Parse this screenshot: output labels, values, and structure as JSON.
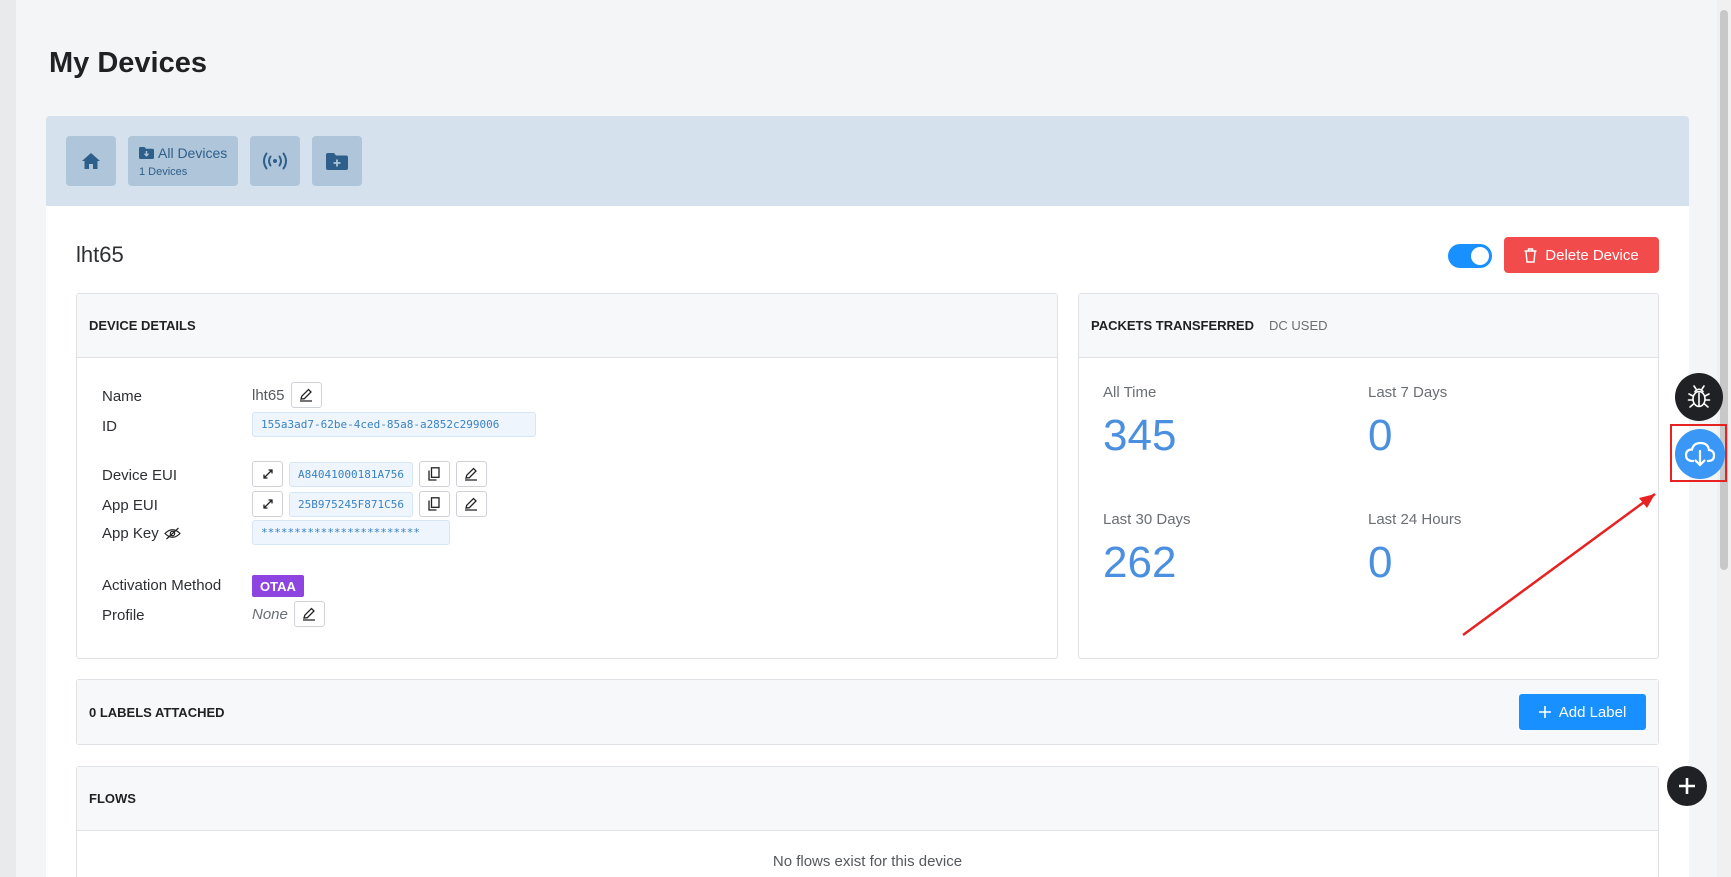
{
  "page": {
    "title": "My Devices"
  },
  "nav": {
    "all_devices_label": "All Devices",
    "all_devices_count": "1 Devices"
  },
  "device": {
    "title": "lht65",
    "enabled": true,
    "delete_label": "Delete Device"
  },
  "details": {
    "header": "DEVICE DETAILS",
    "name_label": "Name",
    "name_value": "lht65",
    "id_label": "ID",
    "id_value": "155a3ad7-62be-4ced-85a8-a2852c299006",
    "dev_eui_label": "Device EUI",
    "dev_eui_value": "A84041000181A756",
    "app_eui_label": "App EUI",
    "app_eui_value": "25B975245F871C56",
    "app_key_label": "App Key",
    "app_key_value": "************************",
    "activation_label": "Activation Method",
    "activation_value": "OTAA",
    "profile_label": "Profile",
    "profile_value": "None"
  },
  "packets": {
    "tab_active": "PACKETS TRANSFERRED",
    "tab_inactive": "DC USED",
    "stats": [
      {
        "label": "All Time",
        "value": "345"
      },
      {
        "label": "Last 7 Days",
        "value": "0"
      },
      {
        "label": "Last 30 Days",
        "value": "262"
      },
      {
        "label": "Last 24 Hours",
        "value": "0"
      }
    ]
  },
  "labels": {
    "header": "0 LABELS ATTACHED",
    "add_label": "Add Label"
  },
  "flows": {
    "header": "FLOWS",
    "empty": "No flows exist for this device"
  },
  "colors": {
    "accent": "#1890ff",
    "danger": "#f24b4b",
    "otaa": "#8e44e0",
    "stat_value": "#4a8fe0"
  }
}
